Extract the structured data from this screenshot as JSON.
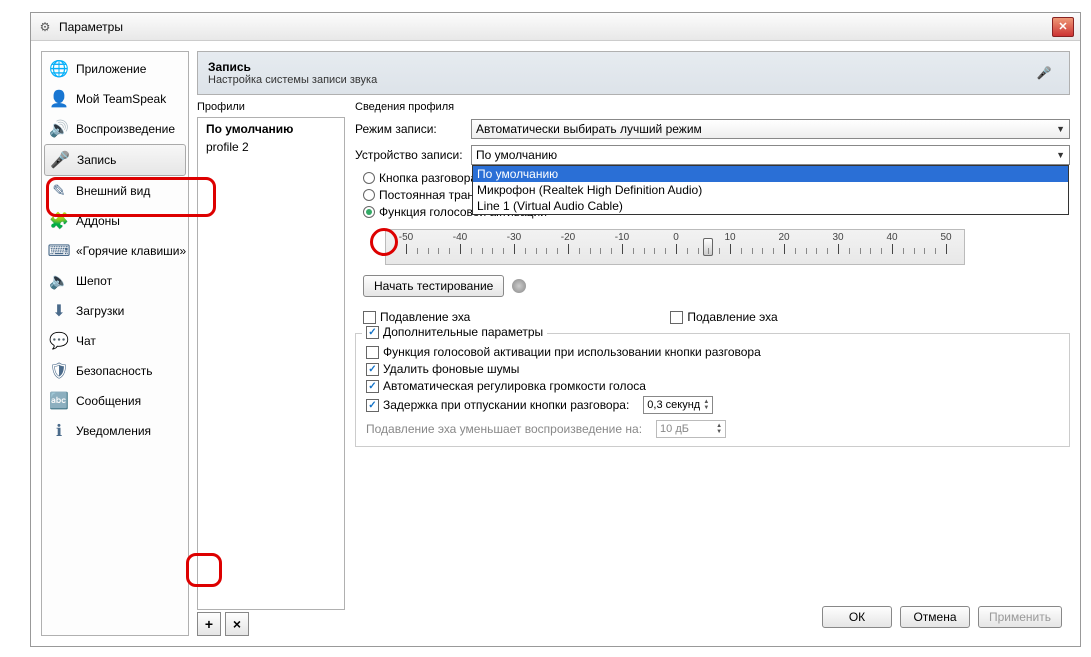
{
  "window": {
    "title": "Параметры"
  },
  "sidebar": {
    "items": [
      {
        "label": "Приложение",
        "icon": "globe-icon"
      },
      {
        "label": "Мой TeamSpeak",
        "icon": "user-icon"
      },
      {
        "label": "Воспроизведение",
        "icon": "speaker-icon"
      },
      {
        "label": "Запись",
        "icon": "mic-icon"
      },
      {
        "label": "Внешний вид",
        "icon": "pen-icon"
      },
      {
        "label": "Аддоны",
        "icon": "puzzle-icon"
      },
      {
        "label": "«Горячие клавиши»",
        "icon": "keyboard-icon"
      },
      {
        "label": "Шепот",
        "icon": "whisper-icon"
      },
      {
        "label": "Загрузки",
        "icon": "download-icon"
      },
      {
        "label": "Чат",
        "icon": "chat-icon"
      },
      {
        "label": "Безопасность",
        "icon": "shield-icon"
      },
      {
        "label": "Сообщения",
        "icon": "abc-icon"
      },
      {
        "label": "Уведомления",
        "icon": "bell-icon"
      }
    ]
  },
  "header": {
    "title": "Запись",
    "subtitle": "Настройка системы записи звука"
  },
  "profiles": {
    "label": "Профили",
    "items": [
      {
        "label": "По умолчанию",
        "bold": true
      },
      {
        "label": "profile 2",
        "bold": false
      }
    ],
    "add_label": "+",
    "del_label": "×"
  },
  "details": {
    "label": "Сведения профиля",
    "mode_label": "Режим записи:",
    "mode_value": "Автоматически выбирать лучший режим",
    "device_label": "Устройство записи:",
    "device_value": "По умолчанию",
    "device_options": [
      "По умолчанию",
      "Микрофон (Realtek High Definition Audio)",
      "Line 1 (Virtual Audio Cable)"
    ],
    "radios": {
      "ptt": "Кнопка разговора",
      "continuous": "Постоянная трансляция",
      "vad": "Функция голосовой активации"
    },
    "slider": {
      "ticks": [
        -50,
        -40,
        -30,
        -20,
        -10,
        0,
        10,
        20,
        30,
        40,
        50
      ],
      "value": 6
    },
    "test_button": "Начать тестирование",
    "echo1": "Подавление эха",
    "echo2": "Подавление эха",
    "advanced_label": "Дополнительные параметры",
    "adv": {
      "vad_with_ptt": "Функция голосовой активации при использовании кнопки разговора",
      "denoise": "Удалить фоновые шумы",
      "agc": "Автоматическая регулировка громкости голоса",
      "delay_label": "Задержка при отпускании кнопки разговора:",
      "delay_value": "0,3 секунд",
      "ducking_label": "Подавление эха уменьшает воспроизведение на:",
      "ducking_value": "10 дБ"
    }
  },
  "footer": {
    "ok": "ОК",
    "cancel": "Отмена",
    "apply": "Применить"
  }
}
